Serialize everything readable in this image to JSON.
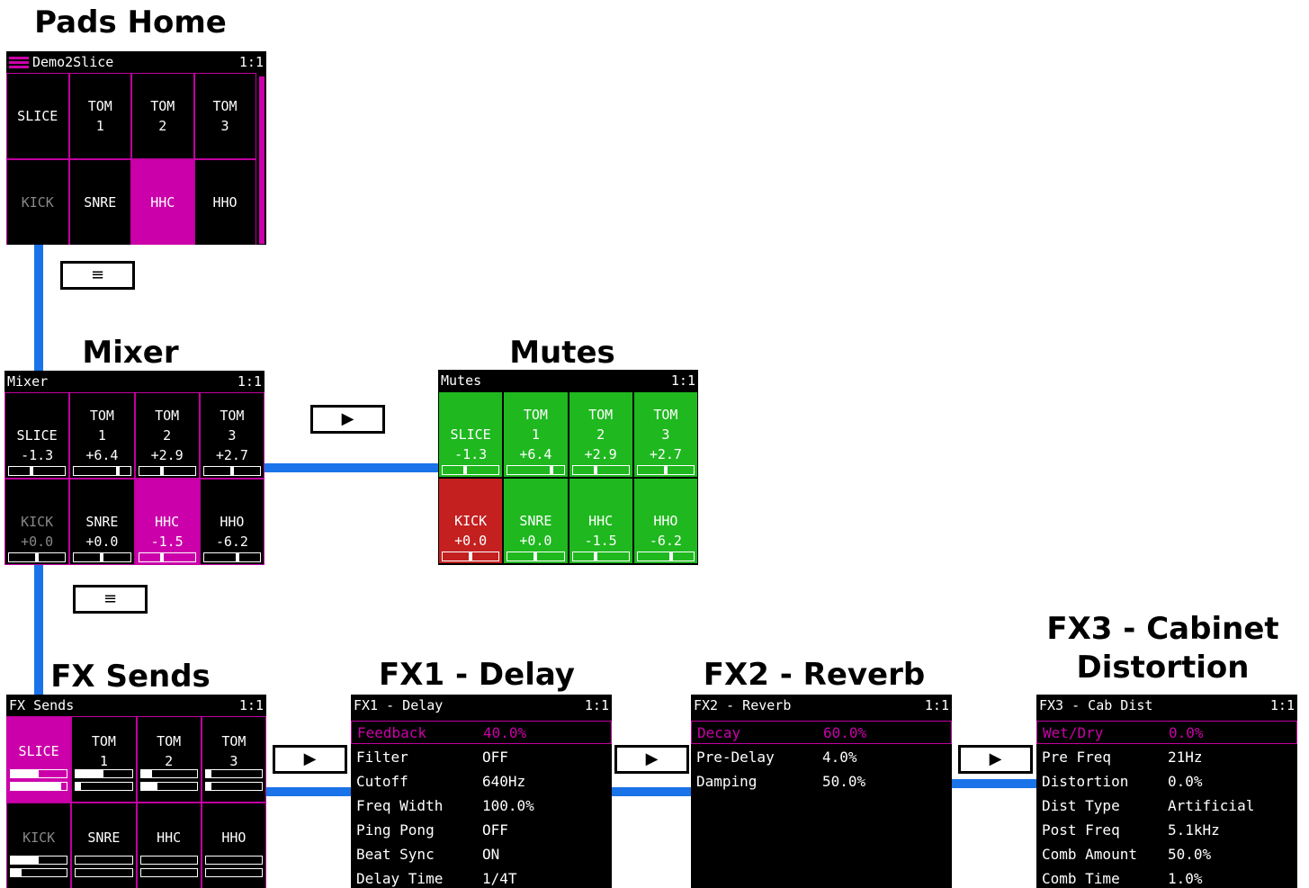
{
  "titles": {
    "pads_home": "Pads Home",
    "mixer": "Mixer",
    "mutes": "Mutes",
    "fx_sends": "FX Sends",
    "fx1": "FX1 - Delay",
    "fx2": "FX2 - Reverb",
    "fx3_line1": "FX3 - Cabinet",
    "fx3_line2": "Distortion"
  },
  "buttons": {
    "menu_glyph": "≡",
    "play_glyph": "▶"
  },
  "colors": {
    "accent": "#cc00aa",
    "connector": "#1a73e8",
    "mute_on": "#1fb81f",
    "mute_off": "#c42020"
  },
  "pads_home": {
    "header_title": "Demo2Slice",
    "header_page": "1:1",
    "pads": [
      "SLICE",
      "TOM\n1",
      "TOM\n2",
      "TOM\n3",
      "KICK",
      "SNRE",
      "HHC",
      "HHO"
    ]
  },
  "mixer": {
    "header_title": "Mixer",
    "header_page": "1:1",
    "pads": [
      {
        "label": "SLICE",
        "value": "-1.3",
        "level": 0.4
      },
      {
        "label": "TOM\n1",
        "value": "+6.4",
        "level": 0.8
      },
      {
        "label": "TOM\n2",
        "value": "+2.9",
        "level": 0.4
      },
      {
        "label": "TOM\n3",
        "value": "+2.7",
        "level": 0.5
      },
      {
        "label": "KICK",
        "value": "+0.0",
        "level": 0.5
      },
      {
        "label": "SNRE",
        "value": "+0.0",
        "level": 0.5
      },
      {
        "label": "HHC",
        "value": "-1.5",
        "level": 0.4
      },
      {
        "label": "HHO",
        "value": "-6.2",
        "level": 0.6
      }
    ]
  },
  "mutes": {
    "header_title": "Mutes",
    "header_page": "1:1",
    "pads": [
      {
        "label": "SLICE",
        "value": "-1.3",
        "level": 0.4
      },
      {
        "label": "TOM\n1",
        "value": "+6.4",
        "level": 0.8
      },
      {
        "label": "TOM\n2",
        "value": "+2.9",
        "level": 0.4
      },
      {
        "label": "TOM\n3",
        "value": "+2.7",
        "level": 0.5
      },
      {
        "label": "KICK",
        "value": "+0.0",
        "level": 0.5
      },
      {
        "label": "SNRE",
        "value": "+0.0",
        "level": 0.5
      },
      {
        "label": "HHC",
        "value": "-1.5",
        "level": 0.4
      },
      {
        "label": "HHO",
        "value": "-6.2",
        "level": 0.6
      }
    ]
  },
  "fx_sends": {
    "header_title": "FX Sends",
    "header_page": "1:1",
    "pads": [
      {
        "label": "SLICE",
        "send1": 0.5,
        "send2": 0.9
      },
      {
        "label": "TOM\n1",
        "send1": 0.5,
        "send2": 0.1
      },
      {
        "label": "TOM\n2",
        "send1": 0.2,
        "send2": 0.3
      },
      {
        "label": "TOM\n3",
        "send1": 0.1,
        "send2": 0.1
      },
      {
        "label": "KICK",
        "send1": 0.5,
        "send2": 0.2
      },
      {
        "label": "SNRE",
        "send1": 0.0,
        "send2": 0.0
      },
      {
        "label": "HHC",
        "send1": 0.0,
        "send2": 0.0
      },
      {
        "label": "HHO",
        "send1": 0.0,
        "send2": 0.0
      }
    ]
  },
  "fx1": {
    "header_title": "FX1 - Delay",
    "header_page": "1:1",
    "params": [
      {
        "name": "Feedback",
        "value": "40.0%"
      },
      {
        "name": "Filter",
        "value": "OFF"
      },
      {
        "name": "Cutoff",
        "value": "640Hz"
      },
      {
        "name": "Freq Width",
        "value": "100.0%"
      },
      {
        "name": "Ping Pong",
        "value": "OFF"
      },
      {
        "name": "Beat Sync",
        "value": "ON"
      },
      {
        "name": "Delay Time",
        "value": "1/4T"
      }
    ]
  },
  "fx2": {
    "header_title": "FX2 - Reverb",
    "header_page": "1:1",
    "params": [
      {
        "name": "Decay",
        "value": "60.0%"
      },
      {
        "name": "Pre-Delay",
        "value": "4.0%"
      },
      {
        "name": "Damping",
        "value": "50.0%"
      }
    ]
  },
  "fx3": {
    "header_title": "FX3 - Cab Dist",
    "header_page": "1:1",
    "params": [
      {
        "name": "Wet/Dry",
        "value": "0.0%"
      },
      {
        "name": "Pre Freq",
        "value": "21Hz"
      },
      {
        "name": "Distortion",
        "value": "0.0%"
      },
      {
        "name": "Dist Type",
        "value": "Artificial"
      },
      {
        "name": "Post Freq",
        "value": "5.1kHz"
      },
      {
        "name": "Comb Amount",
        "value": "50.0%"
      },
      {
        "name": "Comb Time",
        "value": "1.0%"
      }
    ]
  }
}
